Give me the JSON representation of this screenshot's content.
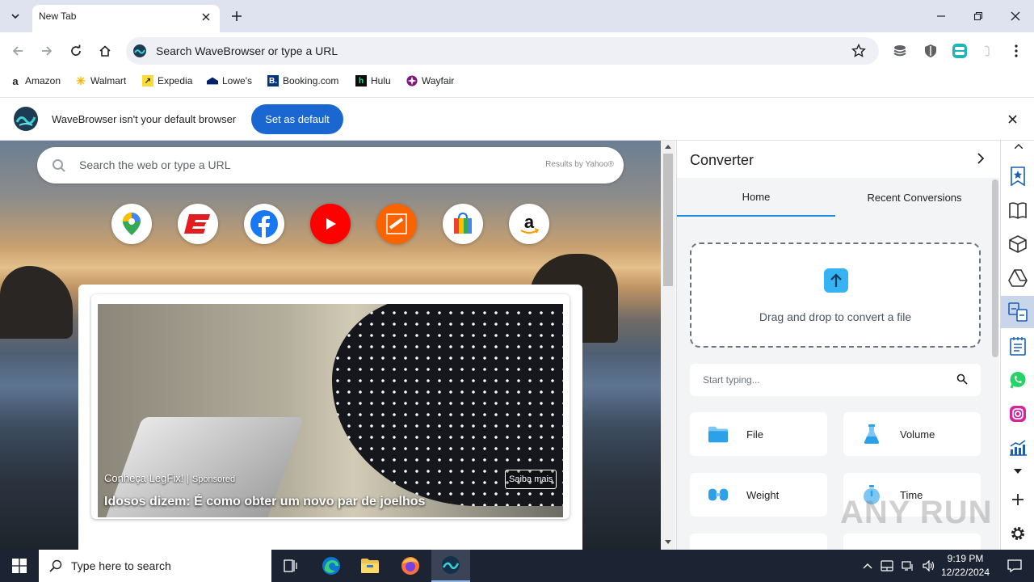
{
  "browser": {
    "tab": {
      "title": "New Tab"
    },
    "omnibox": {
      "text": "Search WaveBrowser or type a URL"
    },
    "bookmarks": [
      {
        "label": "Amazon",
        "icon": "amazon-icon"
      },
      {
        "label": "Walmart",
        "icon": "walmart-icon"
      },
      {
        "label": "Expedia",
        "icon": "expedia-icon"
      },
      {
        "label": "Lowe's",
        "icon": "lowes-icon"
      },
      {
        "label": "Booking.com",
        "icon": "booking-icon"
      },
      {
        "label": "Hulu",
        "icon": "hulu-icon"
      },
      {
        "label": "Wayfair",
        "icon": "wayfair-icon"
      }
    ],
    "infobar": {
      "message": "WaveBrowser isn't your default browser",
      "button": "Set as default"
    }
  },
  "newtab": {
    "search_placeholder": "Search the web or type a URL",
    "search_provider": "Results by Yahoo®",
    "tiles": [
      "maps-icon",
      "espn-icon",
      "facebook-icon",
      "youtube-icon",
      "home-depot-icon",
      "shopping-bag-icon",
      "amazon-icon"
    ],
    "ad": {
      "brand": "Conheça LegFix!",
      "sponsored": "Sponsored",
      "headline": "Idosos dizem: É como obter um novo par de joelhos",
      "cta": "Saiba mais"
    }
  },
  "sidepanel": {
    "title": "Converter",
    "tabs": [
      "Home",
      "Recent Conversions"
    ],
    "active_tab": "Home",
    "dropzone_text": "Drag and drop to convert a file",
    "search_placeholder": "Start typing...",
    "categories": [
      {
        "label": "File",
        "icon": "folder-icon"
      },
      {
        "label": "Volume",
        "icon": "beaker-icon"
      },
      {
        "label": "Weight",
        "icon": "weight-icon"
      },
      {
        "label": "Time",
        "icon": "stopwatch-icon"
      }
    ]
  },
  "watermark": "ANY RUN",
  "taskbar": {
    "search_placeholder": "Type here to search",
    "time": "9:19 PM",
    "date": "12/22/2024"
  },
  "colors": {
    "accent": "#1a67d2",
    "tab_underline": "#1a8fe3",
    "upload": "#35b3f2",
    "taskbar": "#1c2433"
  }
}
